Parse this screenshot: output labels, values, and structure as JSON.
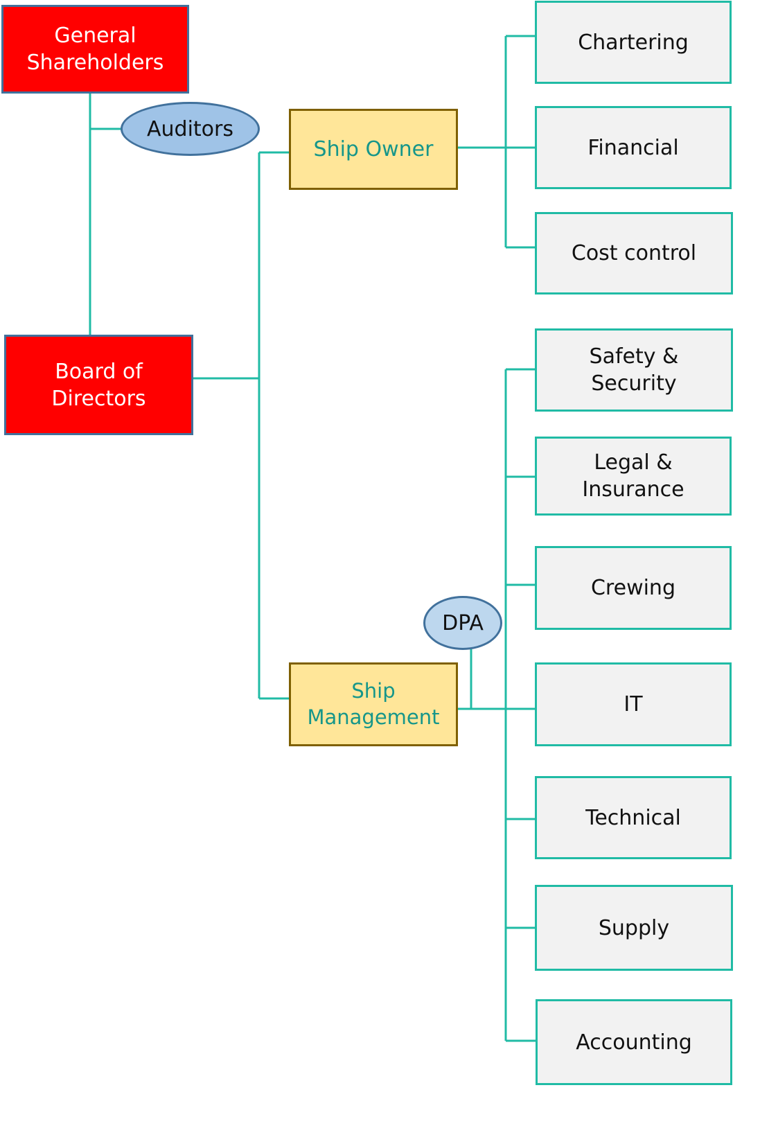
{
  "colors": {
    "top_level": "#ff0000",
    "second_level": "#ffe699",
    "department": "#f2f2f2",
    "connector": "#20bba5",
    "oval": "#9fc3e7"
  },
  "nodes": {
    "general_shareholders": "General Shareholders",
    "auditors": "Auditors",
    "board_of_directors": "Board of Directors",
    "ship_owner": "Ship Owner",
    "ship_management": "Ship Management",
    "dpa": "DPA"
  },
  "ship_owner_departments": [
    "Chartering",
    "Financial",
    "Cost control"
  ],
  "ship_management_departments": [
    "Safety & Security",
    "Legal & Insurance",
    "Crewing",
    "IT",
    "Technical",
    "Supply",
    "Accounting"
  ]
}
